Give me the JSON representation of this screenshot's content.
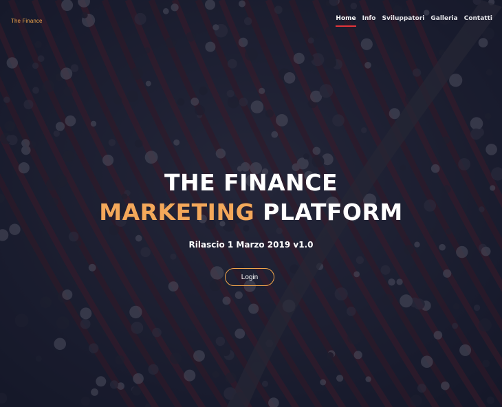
{
  "brand": {
    "name": "The Finance"
  },
  "nav": {
    "items": [
      {
        "label": "Home",
        "active": true
      },
      {
        "label": "Info",
        "active": false
      },
      {
        "label": "Sviluppatori",
        "active": false
      },
      {
        "label": "Galleria",
        "active": false
      },
      {
        "label": "Contatti",
        "active": false
      }
    ]
  },
  "hero": {
    "title_line1": "THE FINANCE",
    "title_accent": "MARKETING",
    "title_rest": "PLATFORM",
    "subtitle": "Rilascio 1 Marzo 2019 v1.0",
    "login_label": "Login",
    "background_image": "conference-audience-photo"
  },
  "colors": {
    "accent": "#f4a85a",
    "nav_active_underline": "#e5353a",
    "text": "#ffffff"
  }
}
